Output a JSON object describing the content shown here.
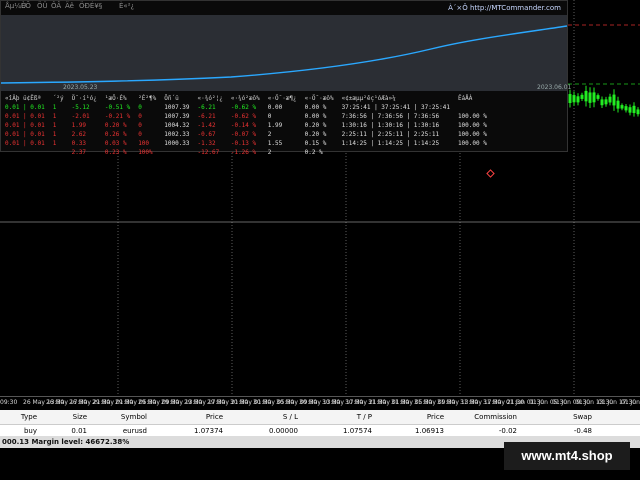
{
  "panel": {
    "tabs": [
      "Åµ¼Ù",
      "ÈÕ",
      "ÖÜ",
      "ÔÂ",
      "Äê",
      "ÖÐÉ¥§",
      "È«²¿"
    ],
    "url": "À´×Ô http://MTCommander.com",
    "graph_label_left": "2023.05.23",
    "graph_label_right": "2023.06.01",
    "headers": [
      "«îÄþ ü¢Ëßª",
      "´²ý",
      "Ö¯·í¹ó¿",
      "¹æÖ·É%",
      "²É²¶%",
      "Õñ´ü",
      "«·¾ó²¦¿",
      "«·¾ó²æô%",
      "«·Ö¯·æ¶¿",
      "«·Ö¯·æô%",
      "«¢±æµµ²êç¹óÆà»¼",
      "ÊáÅÀ"
    ],
    "rows": [
      {
        "cls": "g",
        "c": [
          "0.01 | 0.01",
          "1",
          "-5.12",
          "-0.51 %",
          "0",
          "1007.39",
          "-6.21",
          "-0.62 %",
          "0.00",
          "0.00 %",
          "37:25:41 | 37:25:41 | 37:25:41",
          ""
        ]
      },
      {
        "cls": "r",
        "c": [
          "0.01 | 0.01",
          "1",
          "-2.01",
          "-0.21 %",
          "0",
          "1007.39",
          "-6.21",
          "-0.62 %",
          "0",
          "0.00 %",
          "7:36:56 | 7:36:56 | 7:36:56",
          "100.00 %"
        ]
      },
      {
        "cls": "r",
        "c": [
          "0.01 | 0.01",
          "1",
          "1.99",
          "0.20 %",
          "0",
          "1004.32",
          "-1.42",
          "-0.14 %",
          "1.99",
          "0.20 %",
          "1:30:16 | 1:30:16 | 1:30:16",
          "100.00 %"
        ]
      },
      {
        "cls": "r",
        "c": [
          "0.01 | 0.01",
          "1",
          "2.62",
          "0.26 %",
          "0",
          "1002.33",
          "-0.67",
          "-0.07 %",
          "2",
          "0.20 %",
          "2:25:11 | 2:25:11 | 2:25:11",
          "100.00 %"
        ]
      },
      {
        "cls": "r",
        "c": [
          "0.01 | 0.01",
          "1",
          "0.33",
          "0.03 %",
          "100",
          "1000.33",
          "-1.32",
          "-0.13 %",
          "1.55",
          "0.15 %",
          "1:14:25 | 1:14:25 | 1:14:25",
          "100.00 %"
        ]
      },
      {
        "cls": "r",
        "c": [
          "",
          "",
          "2.37",
          "0.23 %",
          "100%",
          "",
          "-12.67",
          "-1.26 %",
          "2",
          "0.2 %",
          "",
          ""
        ]
      }
    ]
  },
  "time_axis": [
    "09:30",
    "26 May 13:30",
    "26 May 17:30",
    "26 May 21:30",
    "29 May 01:30",
    "29 May 05:30",
    "29 May 09:30",
    "29 May 13:30",
    "29 May 17:30",
    "29 May 21:30",
    "30 May 01:30",
    "30 May 05:30",
    "30 May 09:30",
    "30 May 13:30",
    "30 May 17:30",
    "30 May 21:30",
    "31 May 01:30",
    "31 May 05:30",
    "31 May 09:30",
    "31 May 13:30",
    "31 May 17:30",
    "31 May 21:30",
    "01 Jun 01:30",
    "01 Jun 05:30",
    "01 Jun 09:30",
    "01 Jun 13:30",
    "01 Jun 17:30",
    "01 Jun 21:30"
  ],
  "terminal": {
    "headers": [
      "Type",
      "Size",
      "Symbol",
      "Price",
      "S / L",
      "T / P",
      "Price",
      "Commission",
      "Swap"
    ],
    "row": [
      "buy",
      "0.01",
      "eurusd",
      "1.07374",
      "0.00000",
      "1.07574",
      "1.06913",
      "-0.02",
      "-0.48"
    ],
    "status": "000.13  Margin level: 46672.38%"
  },
  "watermark": "www.mt4.shop",
  "colors": {
    "candle": "#22ee22",
    "equity": "#2aa8ff",
    "level_red": "#e03030",
    "level_green": "#22cc22"
  }
}
